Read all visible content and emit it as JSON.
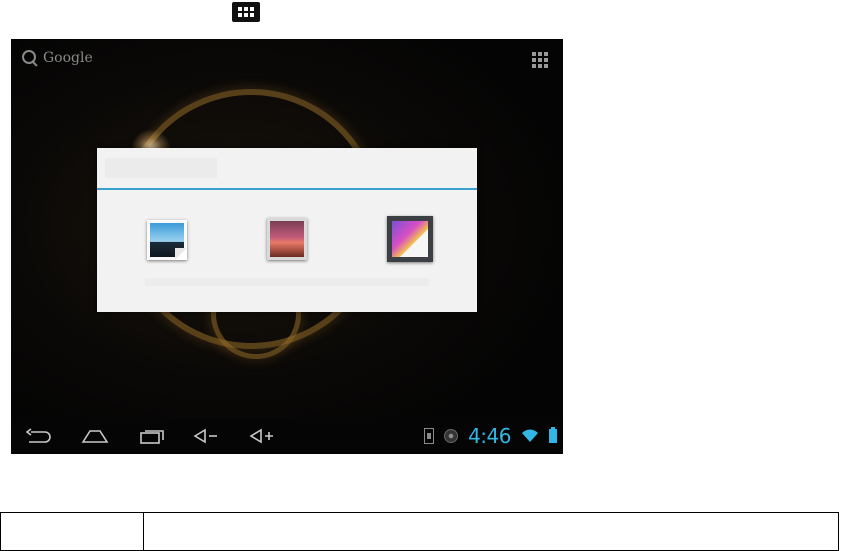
{
  "page": {
    "top_icon": "apps-grid-icon"
  },
  "screen": {
    "search": {
      "label": "Google",
      "icon": "search-icon"
    },
    "apps_icon": "apps-grid-icon",
    "dialog": {
      "title": "",
      "apps": [
        {
          "name": "photo-app-icon",
          "label": ""
        },
        {
          "name": "gallery-app-icon",
          "label": ""
        },
        {
          "name": "photo-editor-app-icon",
          "label": ""
        }
      ]
    },
    "navbar": {
      "buttons": [
        "back-icon",
        "home-icon",
        "recent-apps-icon",
        "volume-down-icon",
        "volume-up-icon"
      ],
      "status": {
        "time": "4:46",
        "icons": [
          "usb-icon",
          "notification-icon",
          "wifi-icon",
          "battery-icon"
        ],
        "clock_color": "#33b5e5"
      }
    }
  },
  "table": {
    "cells": [
      "",
      ""
    ]
  }
}
